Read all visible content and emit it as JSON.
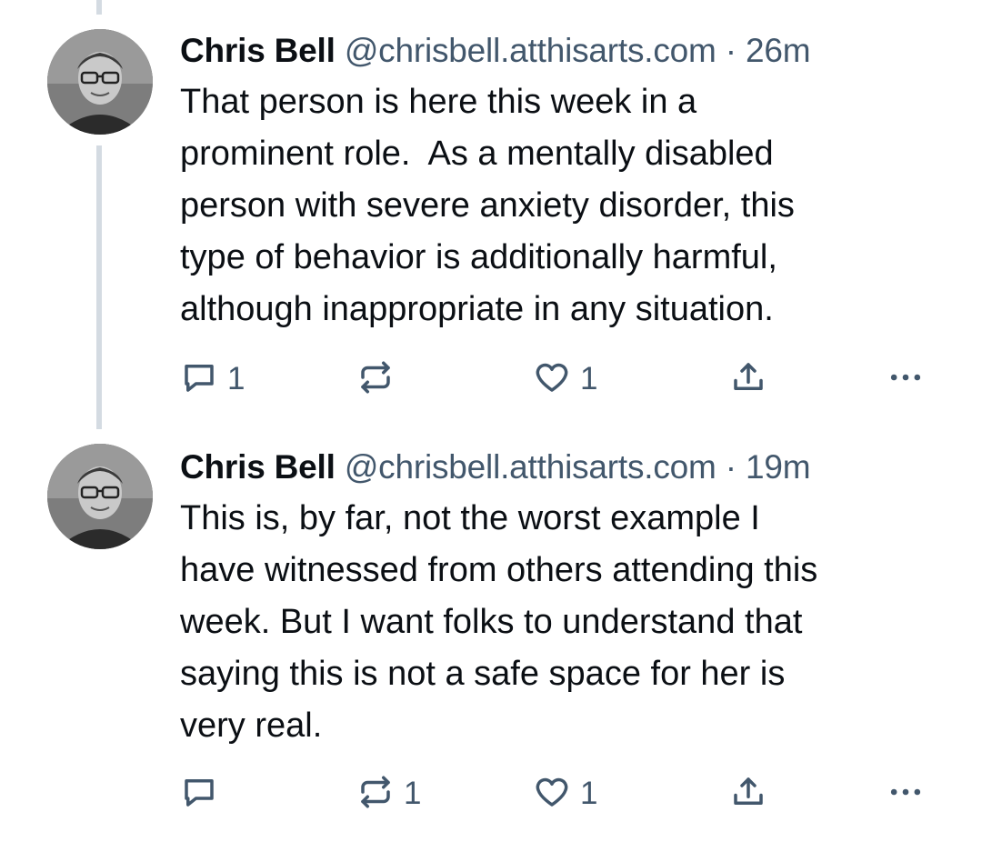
{
  "posts": [
    {
      "author": "Chris Bell",
      "handle": "@chrisbell.atthisarts.com",
      "separator": "·",
      "age": "26m",
      "text": "That person is here this week in a\nprominent role.  As a mentally disabled\nperson with severe anxiety disorder, this\ntype of behavior is additionally harmful,\nalthough inappropriate in any situation.",
      "reply_count": "1",
      "repost_count": "",
      "like_count": "1"
    },
    {
      "author": "Chris Bell",
      "handle": "@chrisbell.atthisarts.com",
      "separator": "·",
      "age": "19m",
      "text": "This is, by far, not the worst example I\nhave witnessed from others attending this\nweek. But I want folks to understand that\nsaying this is not a safe space for her is\nvery real.",
      "reply_count": "",
      "repost_count": "1",
      "like_count": "1"
    }
  ],
  "icons": {
    "reply": "reply-icon",
    "repost": "repost-icon",
    "like": "heart-icon",
    "share": "share-icon",
    "more": "more-icon"
  },
  "colors": {
    "text": "#0b0f14",
    "muted": "#42576c",
    "thread_line": "#d4dbe2"
  }
}
